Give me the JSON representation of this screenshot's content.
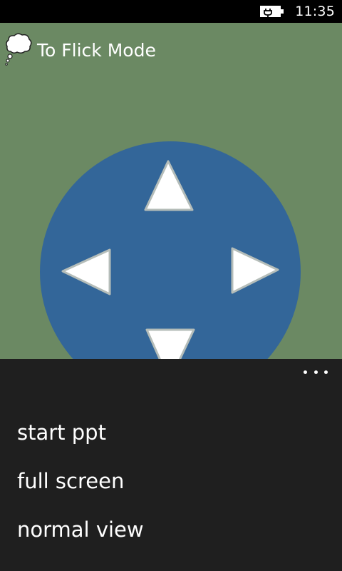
{
  "status_bar": {
    "time": "11:35",
    "battery_icon": "battery-charging-icon"
  },
  "main": {
    "mode_toggle_label": "To Flick Mode",
    "mode_toggle_icon": "thought-bubble-icon",
    "background_color": "#6b8963",
    "dpad_color": "#336699",
    "dpad_icons": [
      "arrow-up-icon",
      "arrow-left-icon",
      "arrow-right-icon",
      "arrow-down-icon"
    ]
  },
  "app_bar": {
    "more_icon": "more-ellipsis-icon",
    "menu_items": [
      {
        "label": "start ppt"
      },
      {
        "label": "full screen"
      },
      {
        "label": "normal view"
      }
    ]
  }
}
